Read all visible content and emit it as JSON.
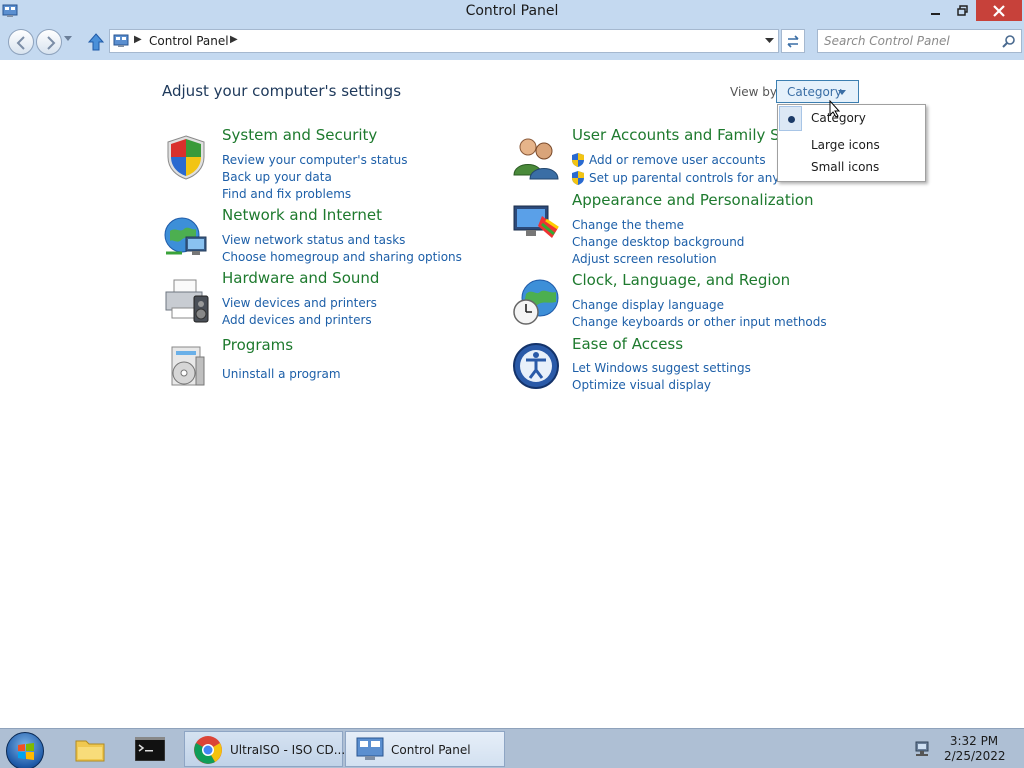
{
  "window": {
    "title": "Control Panel"
  },
  "address": {
    "crumb": "Control Panel"
  },
  "search": {
    "placeholder": "Search Control Panel"
  },
  "content": {
    "heading": "Adjust your computer's settings",
    "view_by_label": "View by:",
    "view_by_value": "Category"
  },
  "view_menu": {
    "items": [
      {
        "label": "Category",
        "selected": true
      },
      {
        "label": "Large icons",
        "selected": false
      },
      {
        "label": "Small icons",
        "selected": false
      }
    ]
  },
  "categories": [
    {
      "title": "System and Security",
      "icon": "shield-icon",
      "links": [
        "Review your computer's status",
        "Back up your data",
        "Find and fix problems"
      ]
    },
    {
      "title": "Network and Internet",
      "icon": "network-globe-icon",
      "links": [
        "View network status and tasks",
        "Choose homegroup and sharing options"
      ]
    },
    {
      "title": "Hardware and Sound",
      "icon": "printer-speaker-icon",
      "links": [
        "View devices and printers",
        "Add devices and printers"
      ]
    },
    {
      "title": "Programs",
      "icon": "programs-icon",
      "links": [
        "Uninstall a program"
      ]
    },
    {
      "title": "User Accounts and Family Saf",
      "icon": "users-icon",
      "links": [
        "Add or remove user accounts",
        "Set up parental controls for any use"
      ]
    },
    {
      "title": "Appearance and Personalization",
      "icon": "monitor-paint-icon",
      "links": [
        "Change the theme",
        "Change desktop background",
        "Adjust screen resolution"
      ]
    },
    {
      "title": "Clock, Language, and Region",
      "icon": "clock-globe-icon",
      "links": [
        "Change display language",
        "Change keyboards or other input methods"
      ]
    },
    {
      "title": "Ease of Access",
      "icon": "ease-of-access-icon",
      "links": [
        "Let Windows suggest settings",
        "Optimize visual display"
      ]
    }
  ],
  "taskbar": {
    "tasks": [
      {
        "label": "UltraISO - ISO CD...",
        "icon": "chrome-icon"
      },
      {
        "label": "Control Panel",
        "icon": "control-panel-icon"
      }
    ],
    "clock_time": "3:32 PM",
    "clock_date": "2/25/2022"
  },
  "colors": {
    "title_bar": "#c4d9f0",
    "category_title": "#1e7a2e",
    "link": "#1d5fa8",
    "close_button": "#c7413a",
    "taskbar": "#aebfd4"
  }
}
